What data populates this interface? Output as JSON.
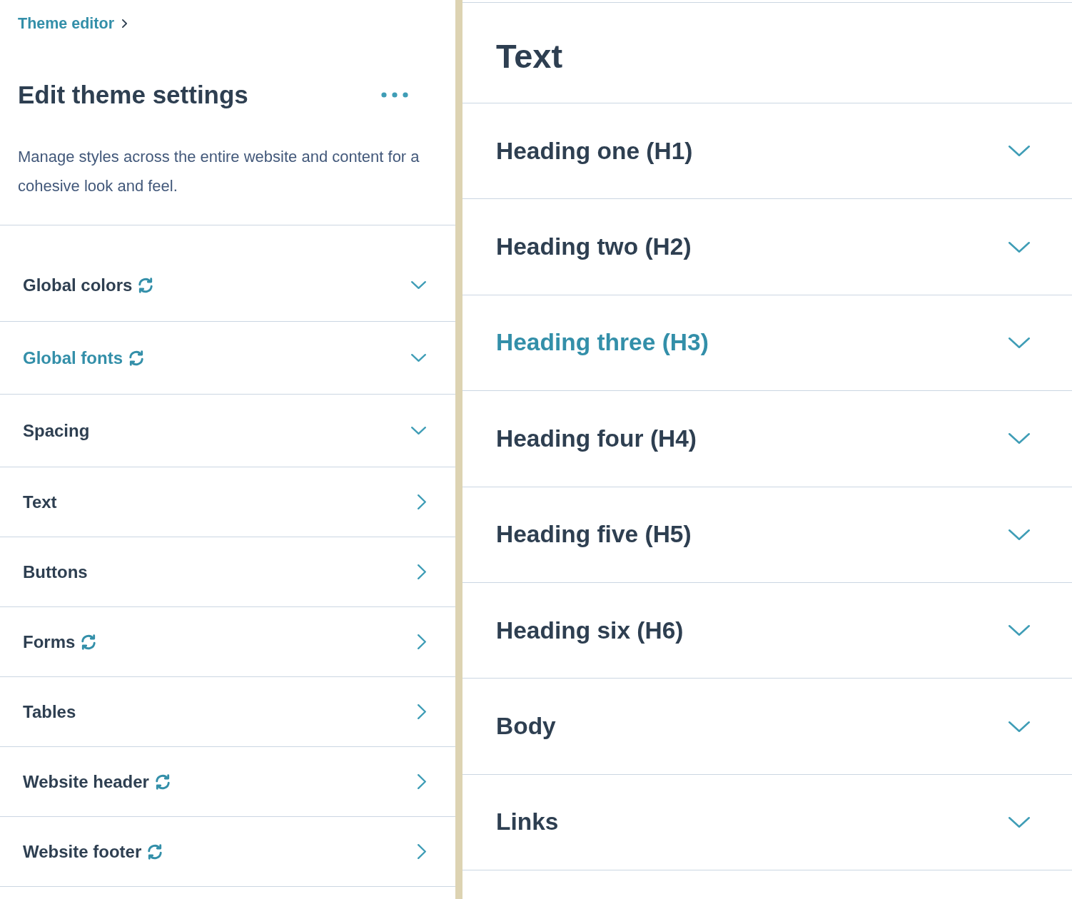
{
  "breadcrumb": {
    "label": "Theme editor"
  },
  "sidebar": {
    "title": "Edit theme settings",
    "description": "Manage styles across the entire website and content for a cohesive look and feel.",
    "items": [
      {
        "label": "Global colors",
        "kind": "accordion",
        "synced": true,
        "selected": false
      },
      {
        "label": "Global fonts",
        "kind": "accordion",
        "synced": true,
        "selected": true
      },
      {
        "label": "Spacing",
        "kind": "accordion",
        "synced": false,
        "selected": false
      },
      {
        "label": "Text",
        "kind": "link",
        "synced": false,
        "selected": false
      },
      {
        "label": "Buttons",
        "kind": "link",
        "synced": false,
        "selected": false
      },
      {
        "label": "Forms",
        "kind": "link",
        "synced": true,
        "selected": false
      },
      {
        "label": "Tables",
        "kind": "link",
        "synced": false,
        "selected": false
      },
      {
        "label": "Website header",
        "kind": "link",
        "synced": true,
        "selected": false
      },
      {
        "label": "Website footer",
        "kind": "link",
        "synced": true,
        "selected": false
      }
    ]
  },
  "content": {
    "title": "Text",
    "items": [
      {
        "label": "Heading one (H1)",
        "selected": false
      },
      {
        "label": "Heading two (H2)",
        "selected": false
      },
      {
        "label": "Heading three (H3)",
        "selected": true
      },
      {
        "label": "Heading four (H4)",
        "selected": false
      },
      {
        "label": "Heading five (H5)",
        "selected": false
      },
      {
        "label": "Heading six (H6)",
        "selected": false
      },
      {
        "label": "Body",
        "selected": false
      },
      {
        "label": "Links",
        "selected": false
      }
    ]
  }
}
